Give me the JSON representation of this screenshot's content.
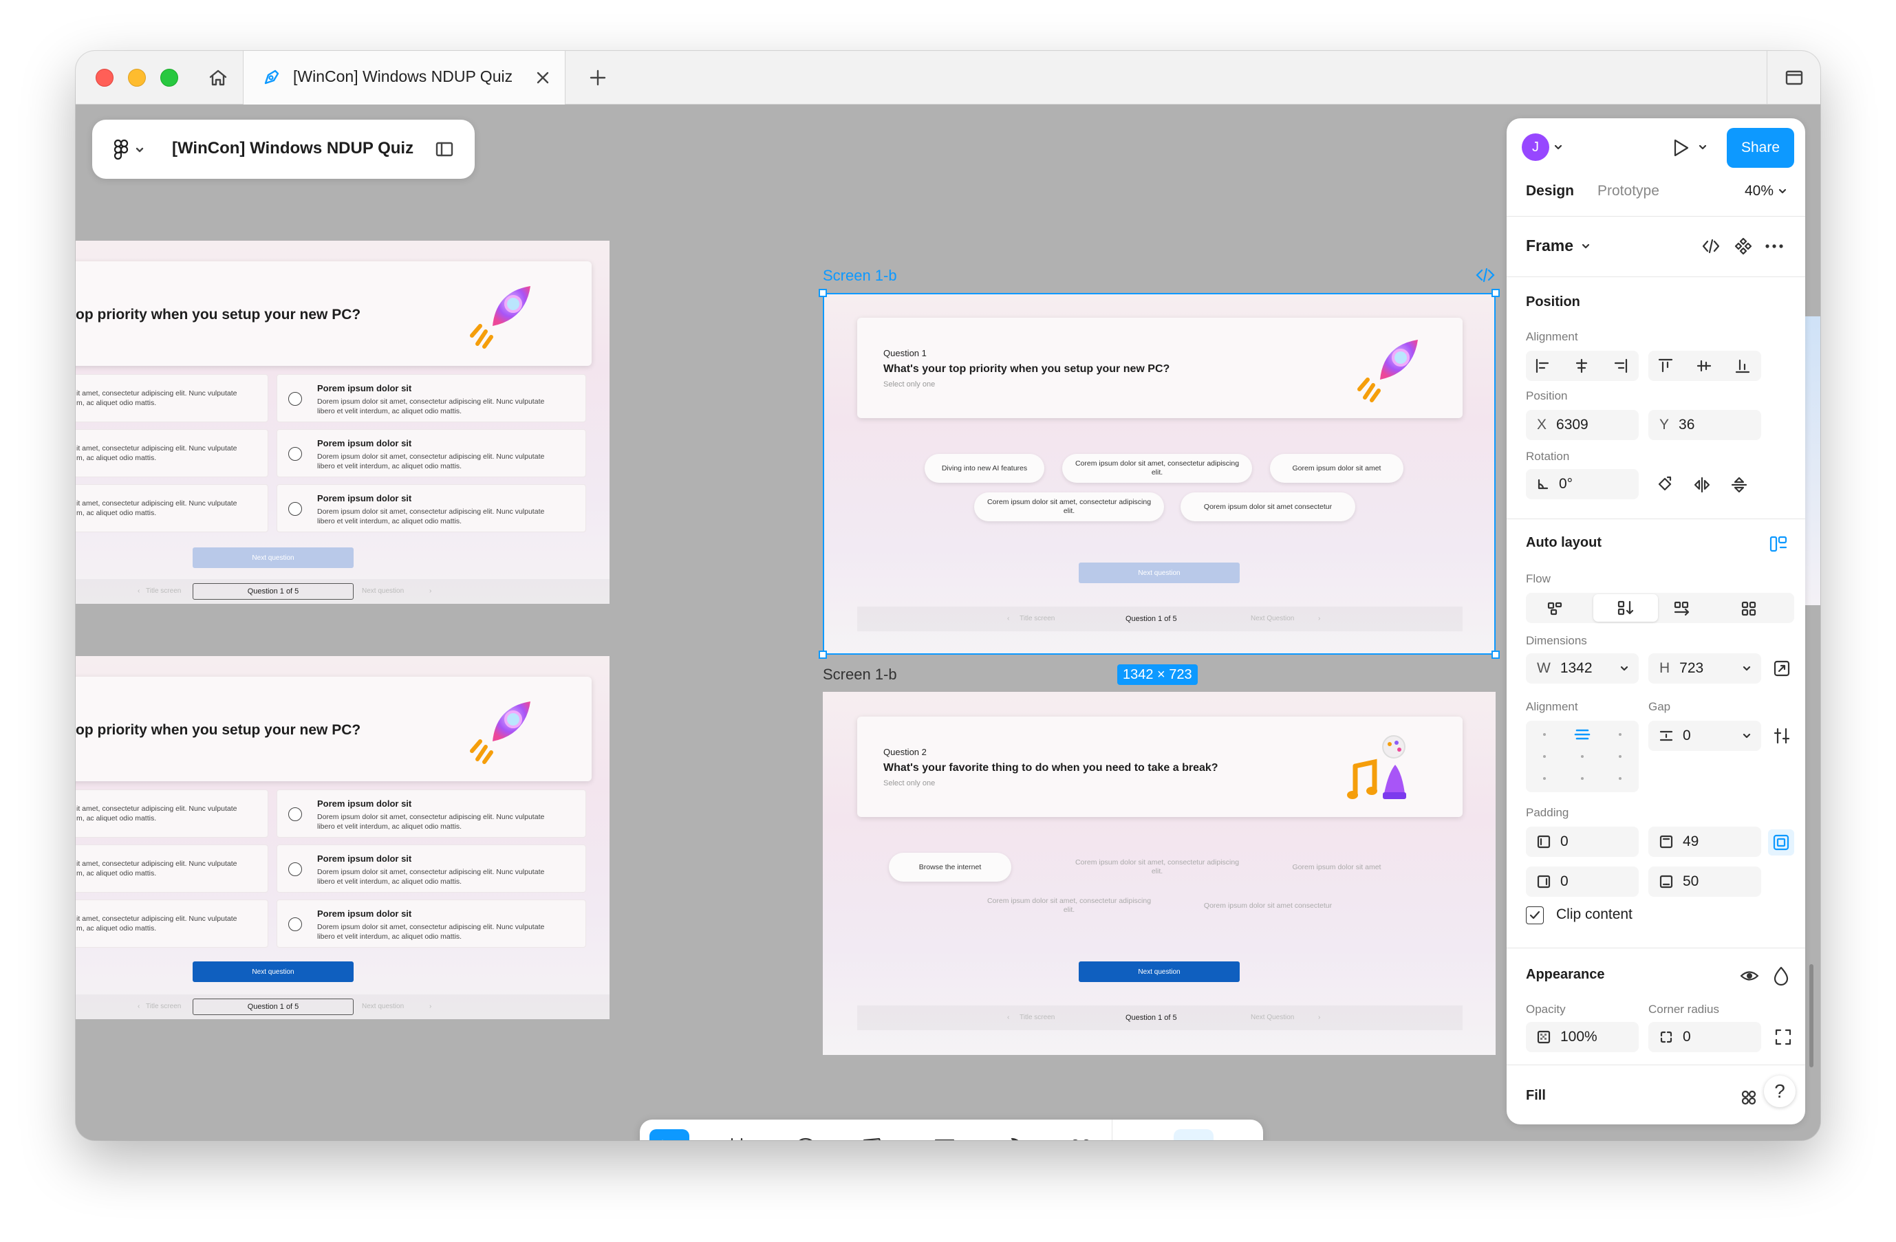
{
  "window": {
    "tab_title": "[WinCon] Windows NDUP Quiz"
  },
  "file_panel": {
    "file_name": "[WinCon] Windows NDUP Quiz"
  },
  "left_frames": [
    {
      "question_text": "op priority when you setup your new PC?",
      "options": [
        {
          "left_text": "it amet, consectetur adipiscing elit. Nunc vulputate\nm, ac aliquet odio mattis.",
          "title": "Porem ipsum dolor sit",
          "body": "Dorem ipsum dolor sit amet, consectetur adipiscing elit. Nunc vulputate\nlibero et velit interdum, ac aliquet odio mattis."
        },
        {
          "left_text": "it amet, consectetur adipiscing elit. Nunc vulputate\nm, ac aliquet odio mattis.",
          "title": "Porem ipsum dolor sit",
          "body": "Dorem ipsum dolor sit amet, consectetur adipiscing elit. Nunc vulputate\nlibero et velit interdum, ac aliquet odio mattis."
        },
        {
          "left_text": "it amet, consectetur adipiscing elit. Nunc vulputate\nm, ac aliquet odio mattis.",
          "title": "Porem ipsum dolor sit",
          "body": "Dorem ipsum dolor sit amet, consectetur adipiscing elit. Nunc vulputate\nlibero et velit interdum, ac aliquet odio mattis."
        }
      ],
      "next_button": "Next question",
      "nav_prev": "Title screen",
      "nav_current": "Question 1 of 5",
      "nav_next": "Next question"
    },
    {
      "question_text": "op priority when you setup your new PC?",
      "options": [
        {
          "left_text": "it amet, consectetur adipiscing elit. Nunc vulputate\nm, ac aliquet odio mattis.",
          "title": "Porem ipsum dolor sit",
          "body": "Dorem ipsum dolor sit amet, consectetur adipiscing elit. Nunc vulputate\nlibero et velit interdum, ac aliquet odio mattis."
        },
        {
          "left_text": "it amet, consectetur adipiscing elit. Nunc vulputate\nm, ac aliquet odio mattis.",
          "title": "Porem ipsum dolor sit",
          "body": "Dorem ipsum dolor sit amet, consectetur adipiscing elit. Nunc vulputate\nlibero et velit interdum, ac aliquet odio mattis."
        },
        {
          "left_text": "it amet, consectetur adipiscing elit. Nunc vulputate\nm, ac aliquet odio mattis.",
          "title": "Porem ipsum dolor sit",
          "body": "Dorem ipsum dolor sit amet, consectetur adipiscing elit. Nunc vulputate\nlibero et velit interdum, ac aliquet odio mattis."
        }
      ],
      "next_button": "Next question",
      "nav_prev": "Title screen",
      "nav_current": "Question 1 of 5",
      "nav_next": "Next question"
    }
  ],
  "frame_selected": {
    "label": "Screen 1-b",
    "size_badge": "1342 × 723",
    "question_label": "Question 1",
    "question_text": "What's your top priority when you setup your new PC?",
    "hint": "Select only one",
    "pills": [
      "Diving into new AI features",
      "Corem ipsum dolor sit amet, consectetur adipiscing elit.",
      "Gorem ipsum dolor sit amet",
      "Corem ipsum dolor sit amet, consectetur adipiscing elit.",
      "Qorem ipsum dolor sit amet consectetur"
    ],
    "next_button": "Next question",
    "nav_prev": "Title screen",
    "nav_current": "Question 1 of 5",
    "nav_next": "Next Question"
  },
  "frame_second": {
    "label": "Screen 1-b",
    "question_label": "Question 2",
    "question_text": "What's your favorite thing to do when you need to take a break?",
    "hint": "Select only one",
    "pills": [
      "Browse the internet",
      "Corem ipsum dolor sit amet, consectetur adipiscing elit.",
      "Gorem ipsum dolor sit amet",
      "Corem ipsum dolor sit amet, consectetur adipiscing elit.",
      "Qorem ipsum dolor sit amet consectetur"
    ],
    "next_button": "Next question",
    "nav_prev": "Title screen",
    "nav_current": "Question 1 of 5",
    "nav_next": "Next Question"
  },
  "properties": {
    "avatar_initial": "J",
    "share_label": "Share",
    "tab_design": "Design",
    "tab_prototype": "Prototype",
    "zoom": "40%",
    "frame_label": "Frame",
    "position_heading": "Position",
    "alignment_label": "Alignment",
    "position_label": "Position",
    "x_key": "X",
    "x_value": "6309",
    "y_key": "Y",
    "y_value": "36",
    "rotation_label": "Rotation",
    "rotation_value": "0°",
    "auto_layout_heading": "Auto layout",
    "flow_label": "Flow",
    "dimensions_label": "Dimensions",
    "w_key": "W",
    "w_value": "1342",
    "h_key": "H",
    "h_value": "723",
    "al_alignment_label": "Alignment",
    "gap_label": "Gap",
    "gap_value": "0",
    "padding_label": "Padding",
    "padding_left": "0",
    "padding_top": "49",
    "padding_right": "0",
    "padding_bottom": "50",
    "clip_content_label": "Clip content",
    "clip_content_checked": true,
    "appearance_heading": "Appearance",
    "opacity_label": "Opacity",
    "opacity_value": "100%",
    "corner_radius_label": "Corner radius",
    "corner_radius_value": "0",
    "fill_heading": "Fill"
  },
  "colors": {
    "accent": "#0d99ff",
    "share_button": "#0d99ff",
    "avatar": "#9747ff",
    "primary_button": "#0f5fbf",
    "disabled_button": "#b9c9e9"
  }
}
